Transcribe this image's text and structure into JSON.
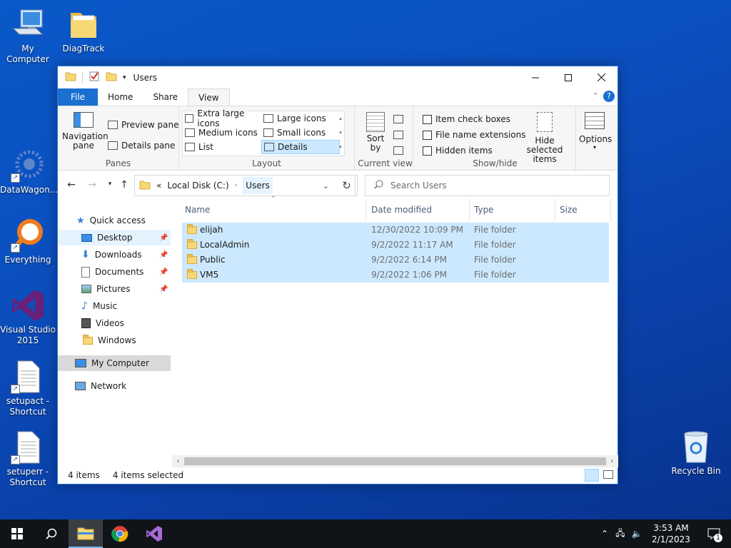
{
  "desktop": {
    "icons": [
      {
        "label": "My Computer"
      },
      {
        "label": "DiagTrack"
      },
      {
        "label": "DataWagon..."
      },
      {
        "label": "Everything"
      },
      {
        "label": "Visual Studio 2015"
      },
      {
        "label": "setupact - Shortcut"
      },
      {
        "label": "setuperr - Shortcut"
      },
      {
        "label": "Recycle Bin"
      }
    ]
  },
  "window": {
    "title": "Users",
    "tabs": [
      "File",
      "Home",
      "Share",
      "View"
    ],
    "active_tab": "View",
    "ribbon": {
      "panes": {
        "navigation_pane": "Navigation pane",
        "preview_pane": "Preview pane",
        "details_pane": "Details pane",
        "label": "Panes"
      },
      "layout": {
        "items": [
          "Extra large icons",
          "Large icons",
          "Medium icons",
          "Small icons",
          "List",
          "Details"
        ],
        "selected": "Details",
        "label": "Layout"
      },
      "current_view": {
        "sort_by": "Sort by",
        "label": "Current view"
      },
      "show_hide": {
        "item_check_boxes": "Item check boxes",
        "file_name_extensions": "File name extensions",
        "hidden_items": "Hidden items",
        "hide_selected_items": "Hide selected items",
        "label": "Show/hide"
      },
      "options": "Options"
    },
    "address": {
      "overflow": "«",
      "crumbs": [
        "Local Disk (C:)",
        "Users"
      ]
    },
    "search": {
      "placeholder": "Search Users"
    },
    "nav_pane": {
      "quick_access": "Quick access",
      "items": [
        "Desktop",
        "Downloads",
        "Documents",
        "Pictures",
        "Music",
        "Videos",
        "Windows"
      ],
      "my_computer": "My Computer",
      "network": "Network"
    },
    "columns": [
      "Name",
      "Date modified",
      "Type",
      "Size"
    ],
    "rows": [
      {
        "name": "elijah",
        "date": "12/30/2022 10:09 PM",
        "type": "File folder",
        "size": ""
      },
      {
        "name": "LocalAdmin",
        "date": "9/2/2022 11:17 AM",
        "type": "File folder",
        "size": ""
      },
      {
        "name": "Public",
        "date": "9/2/2022 6:14 PM",
        "type": "File folder",
        "size": ""
      },
      {
        "name": "VM5",
        "date": "9/2/2022 1:06 PM",
        "type": "File folder",
        "size": ""
      }
    ],
    "status": {
      "count": "4 items",
      "selected": "4 items selected"
    }
  },
  "taskbar": {
    "time": "3:53 AM",
    "date": "2/1/2023",
    "notification_count": "1"
  }
}
